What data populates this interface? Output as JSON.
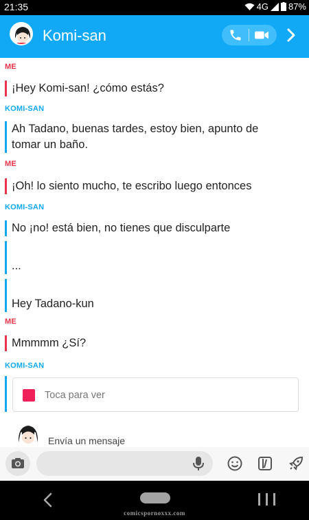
{
  "status_bar": {
    "time": "21:35",
    "network": "4G",
    "battery": "87%"
  },
  "header": {
    "contact_name": "Komi-san",
    "call_icon": "phone-icon",
    "video_icon": "video-camera-icon",
    "more_icon": "chevron-right-icon"
  },
  "conversation": [
    {
      "sender": "ME",
      "messages": [
        "¡Hey Komi-san! ¿cómo estás?"
      ]
    },
    {
      "sender": "KOMI-SAN",
      "messages": [
        "Ah Tadano, buenas tardes, estoy bien, apunto de",
        "tomar un baño."
      ]
    },
    {
      "sender": "ME",
      "messages": [
        "¡Oh! lo siento mucho, te escribo luego entonces"
      ]
    },
    {
      "sender": "KOMI-SAN",
      "messages": [
        "No ¡no! está bien, no tienes que disculparte",
        "...",
        "Hey Tadano-kun"
      ]
    },
    {
      "sender": "ME",
      "messages": [
        "Mmmmm ¿Sí?"
      ]
    },
    {
      "sender": "KOMI-SAN",
      "snap": {
        "label": "Toca para ver",
        "color": "#f0215a"
      }
    }
  ],
  "composer": {
    "hint": "Envía un mensaje",
    "icons": [
      "camera-icon",
      "microphone-icon",
      "smiley-icon",
      "sticker-icon",
      "rocket-icon"
    ]
  },
  "watermark": "comicspornoxxx.com",
  "colors": {
    "header": "#11a9f5",
    "me": "#e8334a",
    "komi": "#10a8f0"
  }
}
